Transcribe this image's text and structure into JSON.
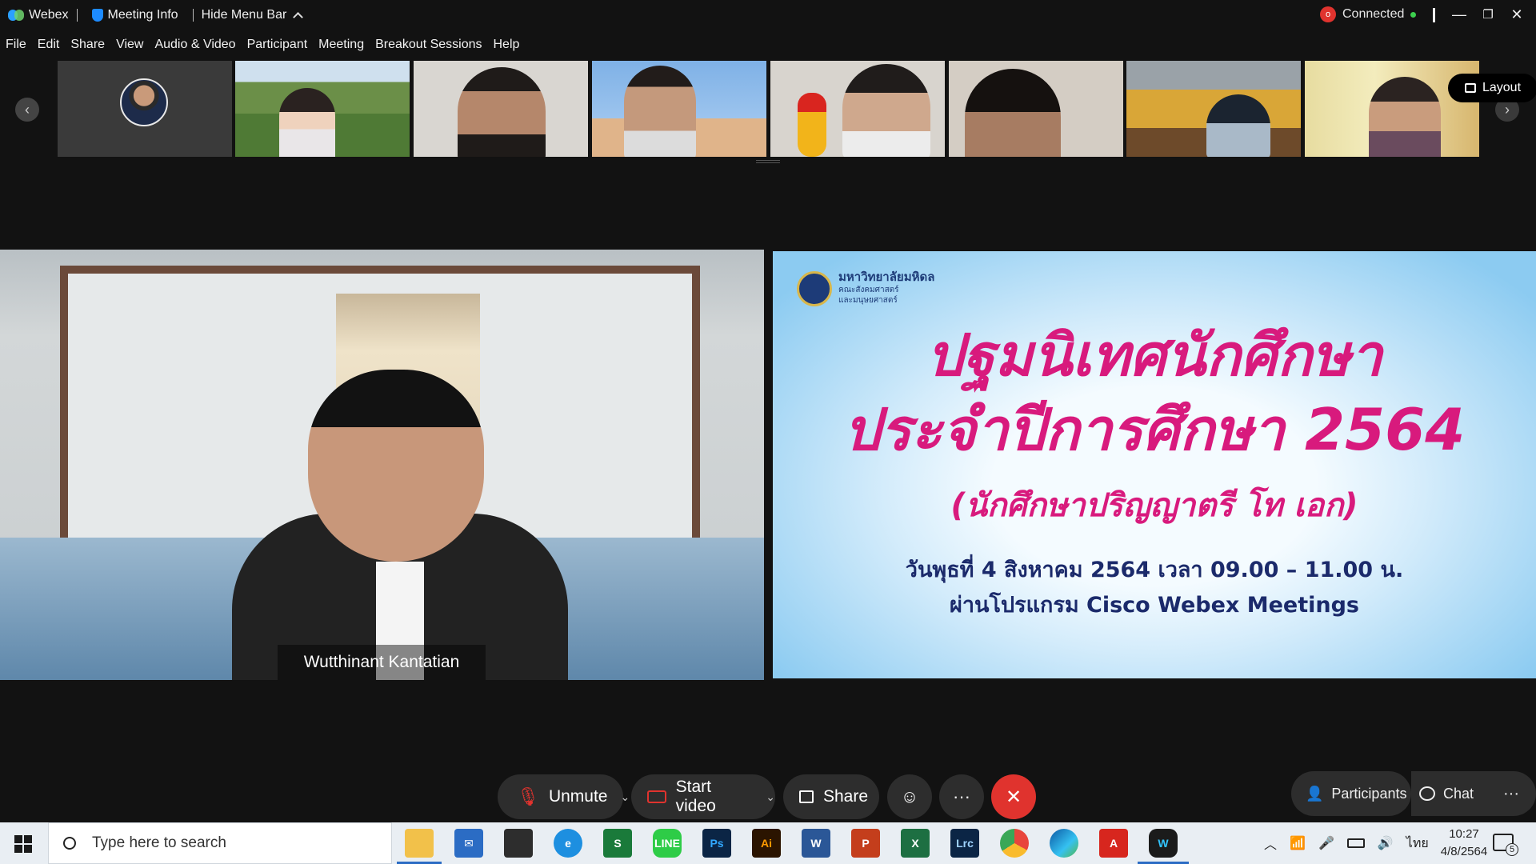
{
  "titlebar": {
    "app_name": "Webex",
    "meeting_info": "Meeting Info",
    "hide_menu": "Hide Menu Bar",
    "status": "Connected",
    "record_badge": "o"
  },
  "menu": [
    "File",
    "Edit",
    "Share",
    "View",
    "Audio & Video",
    "Participant",
    "Meeting",
    "Breakout Sessions",
    "Help"
  ],
  "filmstrip": {
    "layout_label": "Layout"
  },
  "speaker": {
    "name": "Wutthinant Kantatian"
  },
  "slide": {
    "org_line1": "มหาวิทยาลัยมหิดล",
    "org_line2": "คณะสังคมศาสตร์",
    "org_line3": "และมนุษยศาสตร์",
    "title1": "ปฐมนิเทศนักศึกษา",
    "title2": "ประจำปีการศึกษา 2564",
    "subtitle": "(นักศึกษาปริญญาตรี โท เอก)",
    "info1": "วันพุธที่ 4 สิงหาคม 2564 เวลา 09.00 – 11.00 น.",
    "info2": "ผ่านโปรแกรม Cisco Webex Meetings"
  },
  "controls": {
    "unmute": "Unmute",
    "start_video": "Start video",
    "share": "Share",
    "participants": "Participants",
    "chat": "Chat"
  },
  "taskbar": {
    "search_placeholder": "Type here to search",
    "lang": "ไทย",
    "time": "10:27",
    "date": "4/8/2564",
    "notif_count": "5",
    "apps": [
      "Ps",
      "Ai",
      "W",
      "P",
      "X",
      "Lrc"
    ]
  },
  "colors": {
    "accent_red": "#e0332e",
    "slide_pink": "#d81a7d",
    "slide_navy": "#1b2a6b"
  }
}
